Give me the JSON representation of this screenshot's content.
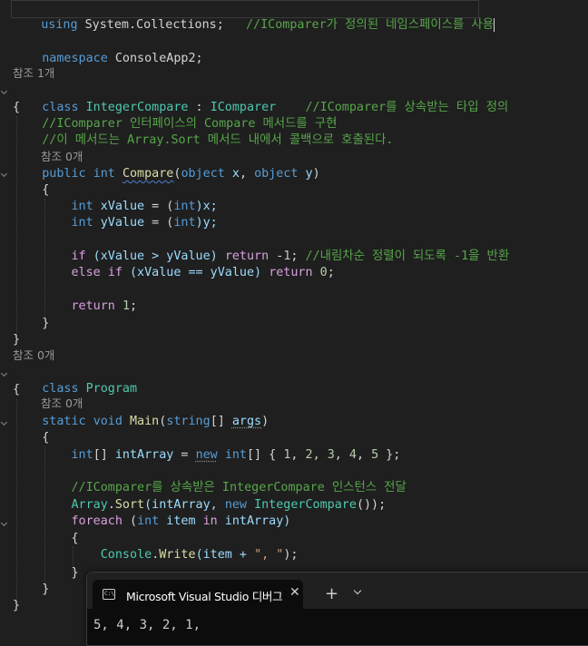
{
  "editor": {
    "l1": {
      "using": "using",
      "ns": "System.Collections;",
      "comment": "//IComparer가 정의된 네임스페이스를 사용"
    },
    "l2": {
      "namespace": "namespace",
      "name": "ConsoleApp2;"
    },
    "ref1": "참조 1개",
    "l3": {
      "class": "class",
      "name": "IntegerCompare",
      "colon": " : ",
      "base": "IComparer",
      "comment": "//IComparer를 상속받는 타입 정의"
    },
    "brace_open": "{",
    "brace_close": "}",
    "c1": "//IComparer 인터페이스의 Compare 메서드를 구현",
    "c2": "//이 메서드는 Array.Sort 메서드 내에서 콜백으로 호출된다.",
    "ref0": "참조 0개",
    "l4": {
      "public": "public",
      "int": "int",
      "method": "Compare",
      "p1": "(",
      "obj1": "object",
      "x": "x",
      "comma": ", ",
      "obj2": "object",
      "y": "y",
      "p2": ")"
    },
    "l5": {
      "int": "int",
      "var": "xValue",
      "eq": " = (",
      "cast": "int",
      "rest": ")x;"
    },
    "l6": {
      "int": "int",
      "var": "yValue",
      "eq": " = (",
      "cast": "int",
      "rest": ")y;"
    },
    "l7": {
      "if": "if",
      "a": " (xValue > yValue) ",
      "ret": "return",
      "b": " -",
      "num": "1",
      "semi": "; ",
      "comment": "//내림차순 정렬이 되도록 -1을 반환"
    },
    "l8": {
      "else": "else",
      "if": "if",
      "a": " (xValue == yValue) ",
      "ret": "return",
      "num": "0",
      "semi": ";"
    },
    "l9": {
      "ret": "return",
      "num": "1",
      "semi": ";"
    },
    "ref2": "참조 0개",
    "l10": {
      "class": "class",
      "name": "Program"
    },
    "ref3": "참조 0개",
    "l11": {
      "static": "static",
      "void": "void",
      "main": "Main",
      "p1": "(",
      "string": "string",
      "arr": "[] ",
      "args": "args",
      "p2": ")"
    },
    "l12": {
      "int": "int",
      "brk": "[] ",
      "var": "intArray",
      "eq": " = ",
      "new": "new",
      "int2": "int",
      "rest": "[] { ",
      "n1": "1",
      "n2": "2",
      "n3": "3",
      "n4": "4",
      "n5": "5",
      "end": " };"
    },
    "c3": "//IComparer를 상속받은 IntegerCompare 인스턴스 전달",
    "l13": {
      "arr": "Array",
      "dot": ".",
      "sort": "Sort",
      "a": "(intArray, ",
      "new": "new",
      "cls": "IntegerCompare",
      "end": "());"
    },
    "l14": {
      "foreach": "foreach",
      "p1": " (",
      "int": "int",
      "item": " item ",
      "in": "in",
      "rest": " intArray)"
    },
    "l15": {
      "console": "Console",
      "dot": ".",
      "write": "Write",
      "a": "(item + ",
      "str": "\", \"",
      "end": ");"
    }
  },
  "console": {
    "title": "Microsoft Visual Studio 디버그",
    "close": "✕",
    "new_tab": "+",
    "output": "5, 4, 3, 2, 1,"
  }
}
